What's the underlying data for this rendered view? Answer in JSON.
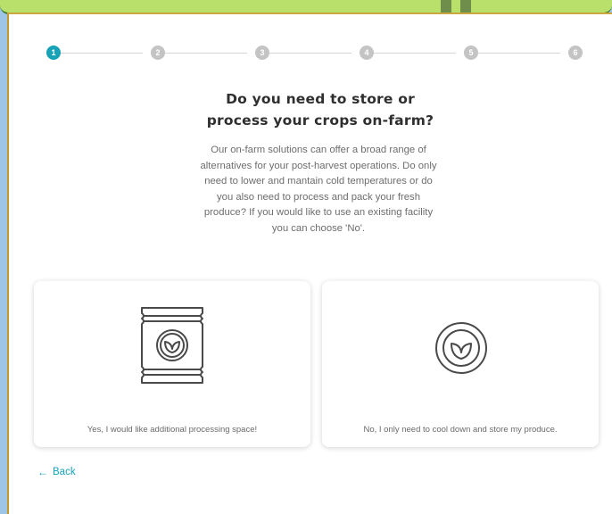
{
  "stepper": {
    "steps": [
      "1",
      "2",
      "3",
      "4",
      "5",
      "6"
    ],
    "active_index": 0,
    "accent": "#17a2b8",
    "inactive": "#c4c4c4"
  },
  "question": {
    "title_line1": "Do you need to store or",
    "title_line2": "process your crops on-farm?",
    "description": "Our on-farm solutions can offer a broad range of alternatives for your post-harvest operations. Do only need to lower and mantain cold temperatures or do you also need to process and pack your fresh produce? If you would like to use an existing facility you can choose 'No'."
  },
  "options": [
    {
      "label": "Yes, I would like additional processing space!",
      "icon": "produce-bag-icon"
    },
    {
      "label": "No, I only need to cool down and store my produce.",
      "icon": "leaf-circle-icon"
    }
  ],
  "nav": {
    "back_label": "Back",
    "back_icon": "arrow-left-icon"
  }
}
